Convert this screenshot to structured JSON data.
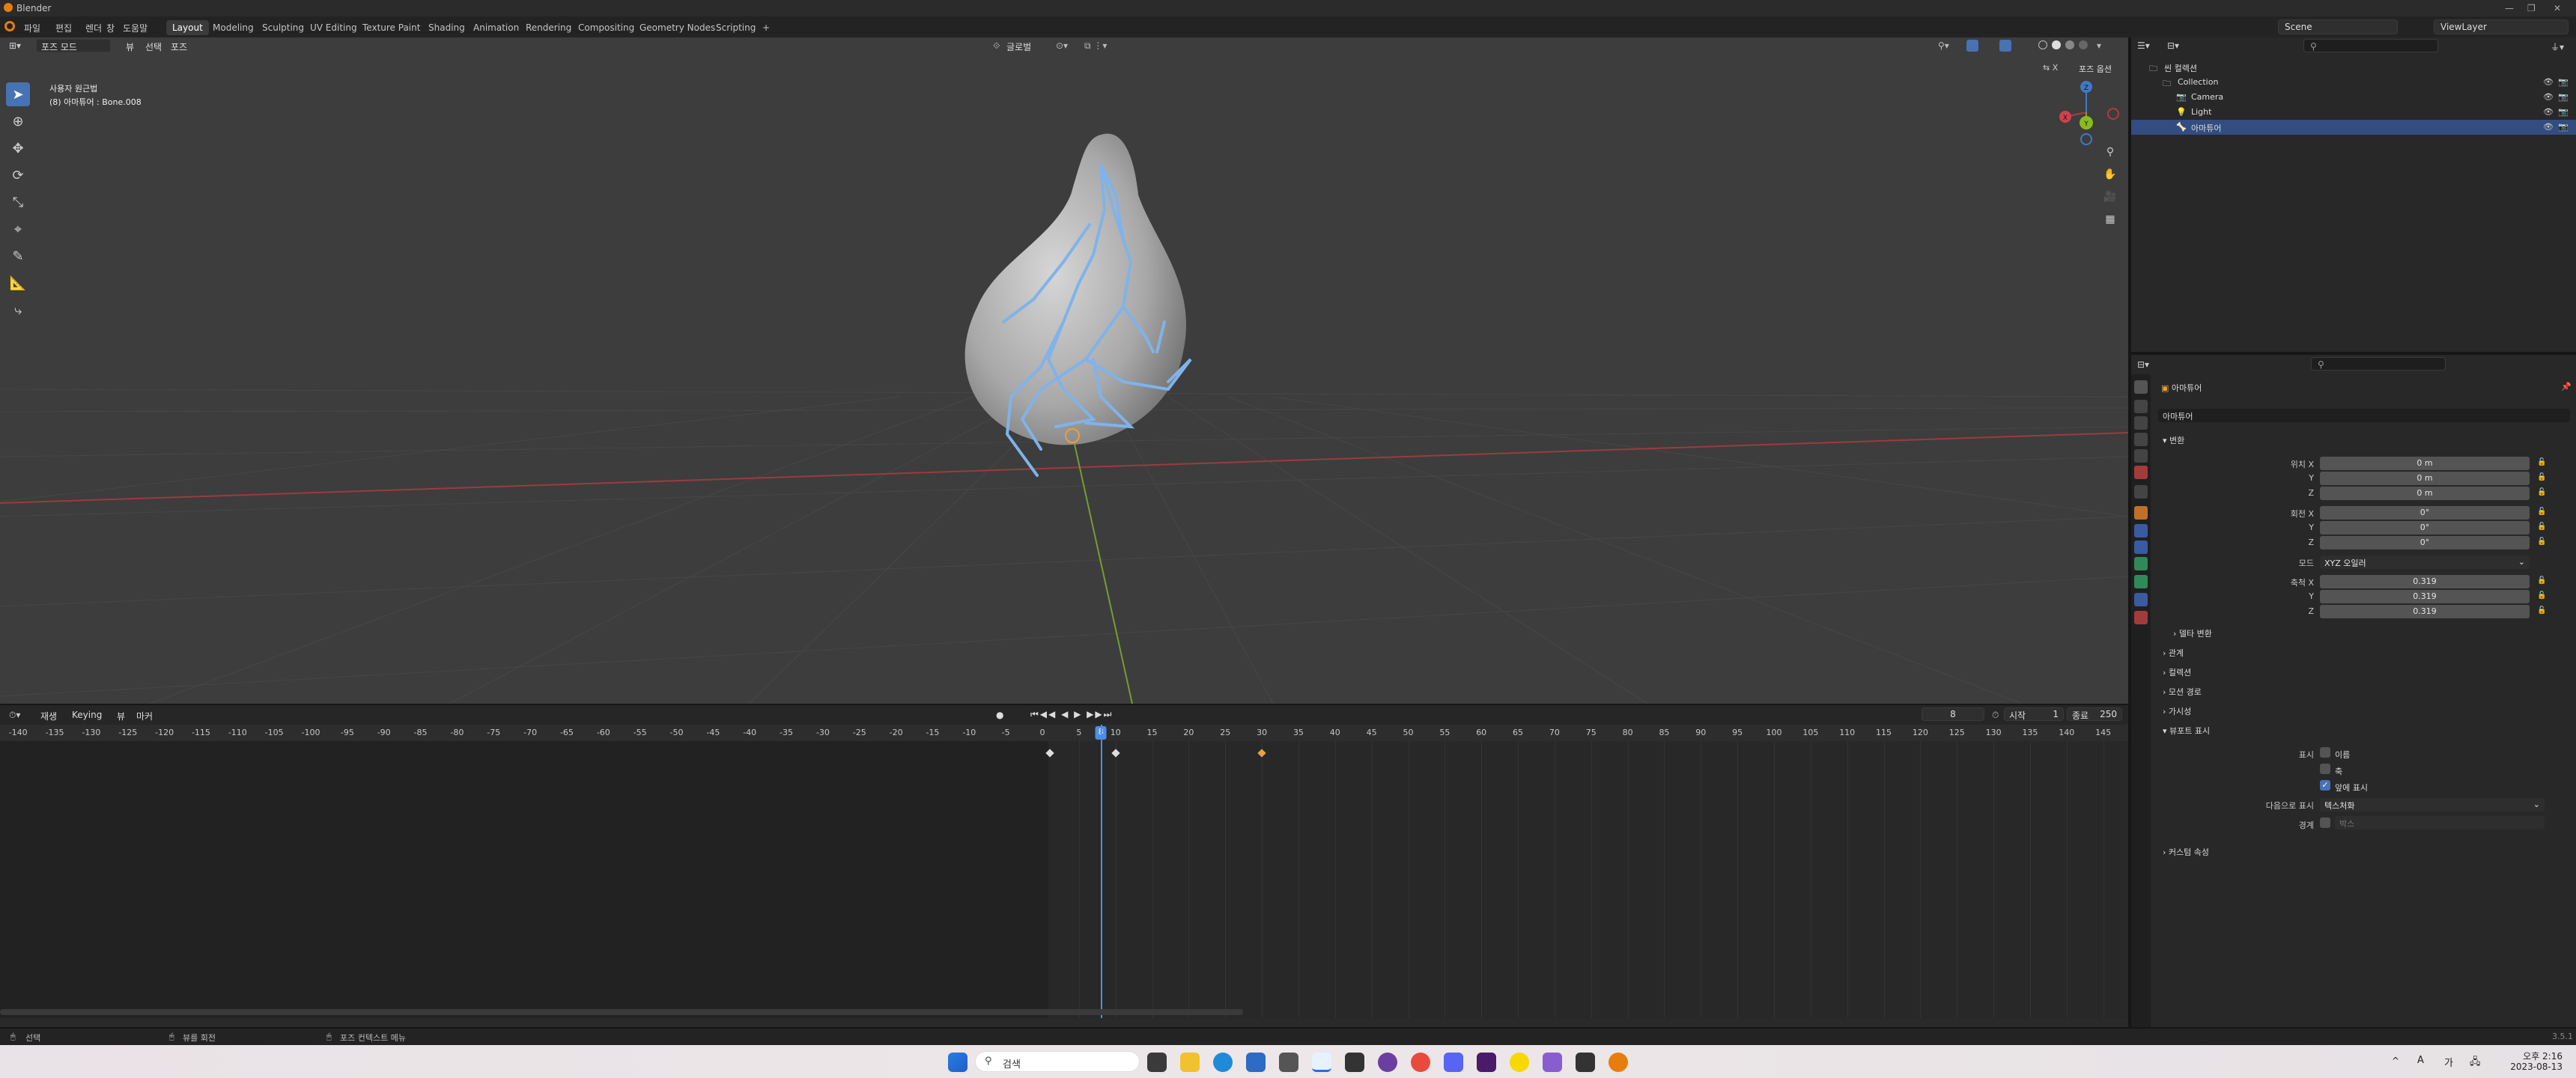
{
  "window": {
    "title": "Blender",
    "controls": [
      "—",
      "❐",
      "✕"
    ]
  },
  "topbar": {
    "menus": [
      "파일",
      "편집",
      "렌더",
      "창",
      "도움말"
    ],
    "workspaces": [
      "Layout",
      "Modeling",
      "Sculpting",
      "UV Editing",
      "Texture Paint",
      "Shading",
      "Animation",
      "Rendering",
      "Compositing",
      "Geometry Nodes",
      "Scripting"
    ],
    "active_workspace": "Layout",
    "add_tab": "+",
    "scene": "Scene",
    "view_layer": "ViewLayer"
  },
  "viewport": {
    "mode": "포즈 모드",
    "menus": [
      "뷰",
      "선택",
      "포즈"
    ],
    "orientation": "글로벌",
    "pose_options": "포즈 옵션",
    "overlay_title": "사용자 원근법",
    "overlay_subtitle": "(8) 아마튜어 : Bone.008",
    "gizmo": {
      "x": "X",
      "y": "Y",
      "z": "Z"
    },
    "colors": {
      "bg": "#3d3d3d",
      "x_axis": "#b03a44",
      "y_axis": "#86a030",
      "z_axis": "#3f79c9",
      "bone": "#7fb3ea"
    }
  },
  "timeline": {
    "menus": [
      "재생",
      "Keying",
      "뷰",
      "마커"
    ],
    "current_frame": "8",
    "start_label": "시작",
    "start": "1",
    "end_label": "종료",
    "end": "250",
    "ruler_ticks": [
      "-140",
      "-135",
      "-130",
      "-125",
      "-120",
      "-115",
      "-110",
      "-105",
      "-100",
      "-95",
      "-90",
      "-85",
      "-80",
      "-75",
      "-70",
      "-65",
      "-60",
      "-55",
      "-50",
      "-45",
      "-40",
      "-35",
      "-30",
      "-25",
      "-20",
      "-15",
      "-10",
      "-5",
      "0",
      "5",
      "10",
      "15",
      "20",
      "25",
      "30",
      "35",
      "40",
      "45",
      "50",
      "55",
      "60",
      "65",
      "70",
      "75",
      "80",
      "85",
      "90",
      "95",
      "100",
      "105",
      "110",
      "115",
      "120",
      "125",
      "130",
      "135",
      "140",
      "145"
    ],
    "keyframes": [
      1,
      10,
      30
    ]
  },
  "statusbar": {
    "items": [
      "선택",
      "뷰를 회전",
      "포즈 컨텍스트 메뉴"
    ],
    "version": "3.5.1"
  },
  "outliner": {
    "search_placeholder": "",
    "rows": [
      {
        "label": "씬 컬렉션",
        "indent": 0,
        "selected": false
      },
      {
        "label": "Collection",
        "indent": 1,
        "selected": false
      },
      {
        "label": "Camera",
        "indent": 2,
        "selected": false
      },
      {
        "label": "Light",
        "indent": 2,
        "selected": false
      },
      {
        "label": "아마튜어",
        "indent": 2,
        "selected": true
      }
    ]
  },
  "properties": {
    "object_name": "아마튜어",
    "data_name": "아마튜어",
    "transform_header": "변환",
    "location_label": "위치 X",
    "location": [
      "0 m",
      "0 m",
      "0 m"
    ],
    "rotation_label": "회전 X",
    "rotation": [
      "0°",
      "0°",
      "0°"
    ],
    "mode_label": "모드",
    "mode_value": "XYZ 오일러",
    "scale_label": "축척 X",
    "scale": [
      "0.319",
      "0.319",
      "0.319"
    ],
    "axis_y": "Y",
    "axis_z": "Z",
    "sections": [
      "델타 변환",
      "관계",
      "컬렉션",
      "모션 경로",
      "가시성",
      "뷰포트 표시"
    ],
    "display_label": "표시",
    "display_name": "이름",
    "display_axis": "축",
    "display_front": "앞에 표시",
    "display_as_label": "다음으로 표시",
    "display_as_value": "텍스처화",
    "bounds_label": "경계",
    "bounds_value": "박스",
    "custom_props": "커스텀 속성"
  },
  "taskbar": {
    "search": "검색",
    "time": "오후 2:16",
    "date": "2023-08-13",
    "lang": "가",
    "tray": [
      "^",
      "A"
    ]
  }
}
